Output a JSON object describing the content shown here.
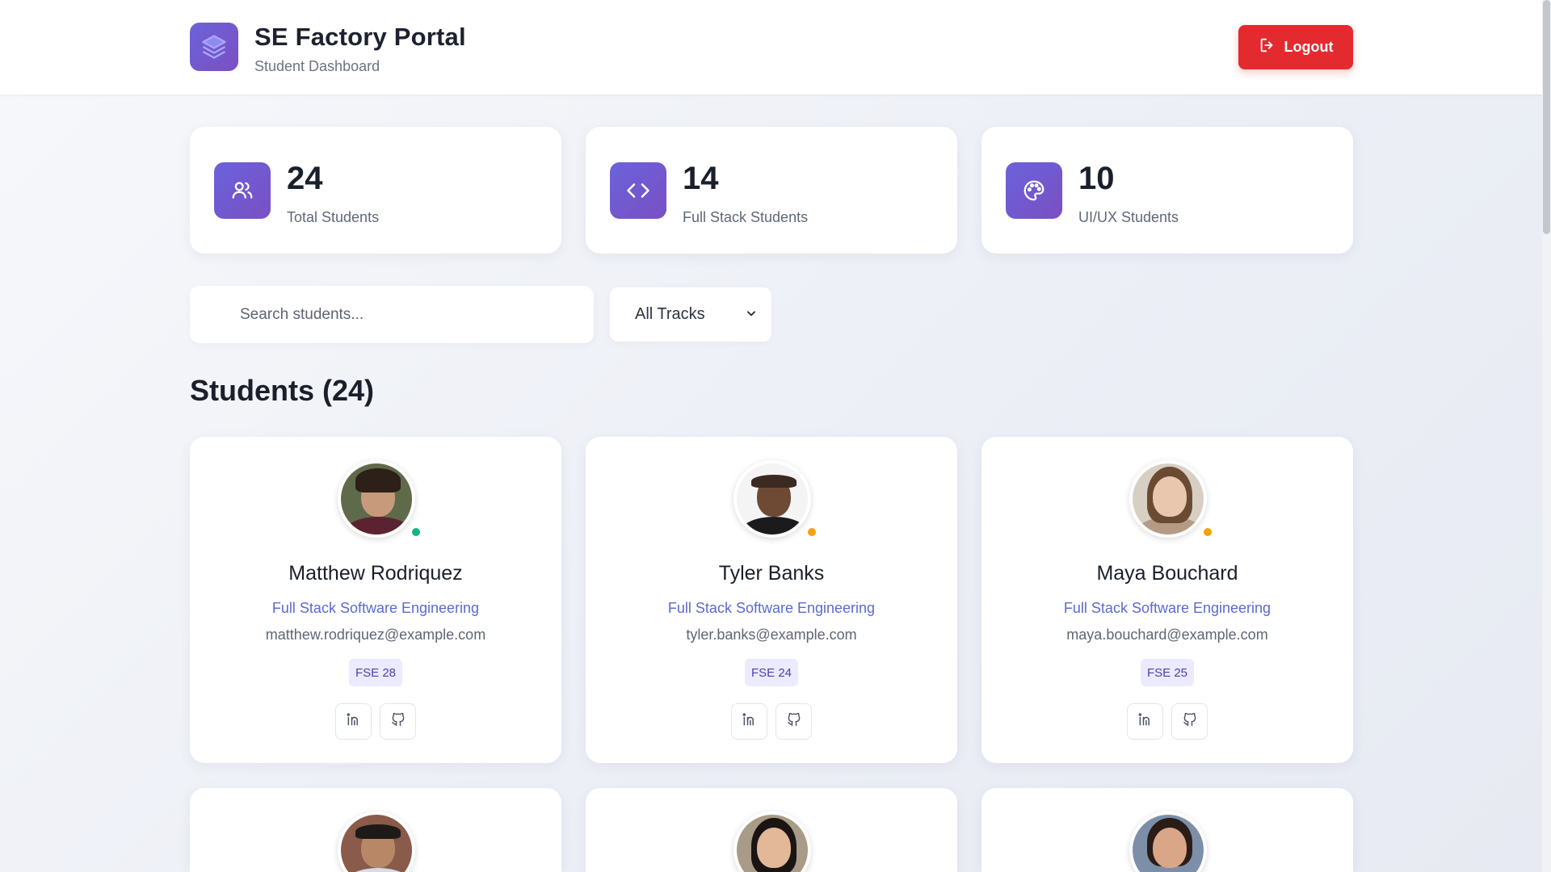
{
  "header": {
    "title": "SE Factory Portal",
    "subtitle": "Student Dashboard",
    "logout_label": "Logout",
    "logo_icon": "stack-layers-icon"
  },
  "colors": {
    "accent": "#6c63d9",
    "logout": "#e32a2f",
    "online": "#16b57f",
    "away": "#f5a30a",
    "track_link": "#5b6ad0"
  },
  "stats": [
    {
      "value": "24",
      "label": "Total Students",
      "icon": "users-icon"
    },
    {
      "value": "14",
      "label": "Full Stack Students",
      "icon": "code-icon"
    },
    {
      "value": "10",
      "label": "UI/UX Students",
      "icon": "palette-icon"
    }
  ],
  "filters": {
    "search_placeholder": "Search students...",
    "track_selected": "All Tracks"
  },
  "section": {
    "title": "Students (24)"
  },
  "students": [
    {
      "name": "Matthew Rodriquez",
      "track": "Full Stack Software Engineering",
      "email": "matthew.rodriquez@example.com",
      "cohort": "FSE 28",
      "status": "online"
    },
    {
      "name": "Tyler Banks",
      "track": "Full Stack Software Engineering",
      "email": "tyler.banks@example.com",
      "cohort": "FSE 24",
      "status": "away"
    },
    {
      "name": "Maya Bouchard",
      "track": "Full Stack Software Engineering",
      "email": "maya.bouchard@example.com",
      "cohort": "FSE 25",
      "status": "away"
    }
  ]
}
